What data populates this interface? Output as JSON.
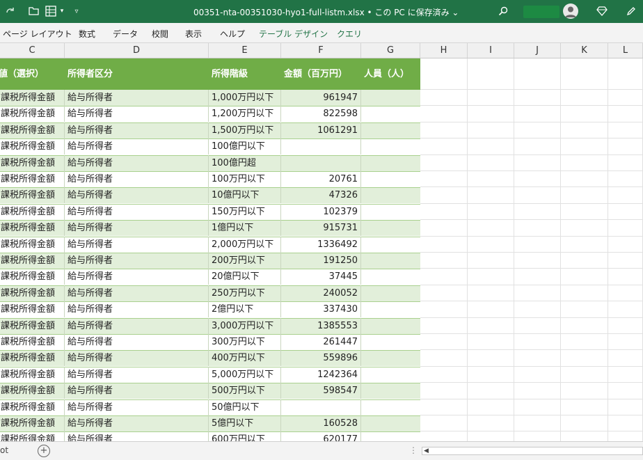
{
  "titlebar": {
    "title": "00351-nta-00351030-hyo1-full-listm.xlsx • この PC に保存済み ⌄",
    "icons": [
      "redo-icon",
      "open-folder-icon",
      "form-icon",
      "customize-qat-icon",
      "search-icon",
      "account-avatar-icon",
      "premium-diamond-icon",
      "pen-icon"
    ]
  },
  "ribbon": {
    "tabs": [
      "ページ レイアウト",
      "数式",
      "データ",
      "校閲",
      "表示",
      "ヘルプ",
      "テーブル デザイン",
      "クエリ"
    ]
  },
  "columns": [
    "C",
    "D",
    "E",
    "F",
    "G",
    "H",
    "I",
    "J",
    "K",
    "L"
  ],
  "table": {
    "headers": [
      "値（選択）",
      "所得者区分",
      "所得階級",
      "金額（百万円）",
      "人員（人）"
    ],
    "rows": [
      {
        "c": "課税所得金額",
        "d": "給与所得者",
        "e": "1,000万円以下",
        "f": "961947",
        "g": ""
      },
      {
        "c": "課税所得金額",
        "d": "給与所得者",
        "e": "1,200万円以下",
        "f": "822598",
        "g": ""
      },
      {
        "c": "課税所得金額",
        "d": "給与所得者",
        "e": "1,500万円以下",
        "f": "1061291",
        "g": ""
      },
      {
        "c": "課税所得金額",
        "d": "給与所得者",
        "e": "100億円以下",
        "f": "",
        "g": ""
      },
      {
        "c": "課税所得金額",
        "d": "給与所得者",
        "e": "100億円超",
        "f": "",
        "g": ""
      },
      {
        "c": "課税所得金額",
        "d": "給与所得者",
        "e": "100万円以下",
        "f": "20761",
        "g": ""
      },
      {
        "c": "課税所得金額",
        "d": "給与所得者",
        "e": "10億円以下",
        "f": "47326",
        "g": ""
      },
      {
        "c": "課税所得金額",
        "d": "給与所得者",
        "e": "150万円以下",
        "f": "102379",
        "g": ""
      },
      {
        "c": "課税所得金額",
        "d": "給与所得者",
        "e": "1億円以下",
        "f": "915731",
        "g": ""
      },
      {
        "c": "課税所得金額",
        "d": "給与所得者",
        "e": "2,000万円以下",
        "f": "1336492",
        "g": ""
      },
      {
        "c": "課税所得金額",
        "d": "給与所得者",
        "e": "200万円以下",
        "f": "191250",
        "g": ""
      },
      {
        "c": "課税所得金額",
        "d": "給与所得者",
        "e": "20億円以下",
        "f": "37445",
        "g": ""
      },
      {
        "c": "課税所得金額",
        "d": "給与所得者",
        "e": "250万円以下",
        "f": "240052",
        "g": ""
      },
      {
        "c": "課税所得金額",
        "d": "給与所得者",
        "e": "2億円以下",
        "f": "337430",
        "g": ""
      },
      {
        "c": "課税所得金額",
        "d": "給与所得者",
        "e": "3,000万円以下",
        "f": "1385553",
        "g": ""
      },
      {
        "c": "課税所得金額",
        "d": "給与所得者",
        "e": "300万円以下",
        "f": "261447",
        "g": ""
      },
      {
        "c": "課税所得金額",
        "d": "給与所得者",
        "e": "400万円以下",
        "f": "559896",
        "g": ""
      },
      {
        "c": "課税所得金額",
        "d": "給与所得者",
        "e": "5,000万円以下",
        "f": "1242364",
        "g": ""
      },
      {
        "c": "課税所得金額",
        "d": "給与所得者",
        "e": "500万円以下",
        "f": "598547",
        "g": ""
      },
      {
        "c": "課税所得金額",
        "d": "給与所得者",
        "e": "50億円以下",
        "f": "",
        "g": ""
      },
      {
        "c": "課税所得金額",
        "d": "給与所得者",
        "e": "5億円以下",
        "f": "160528",
        "g": ""
      },
      {
        "c": "課税所得金額",
        "d": "給与所得者",
        "e": "600万円以下",
        "f": "620177",
        "g": ""
      }
    ]
  },
  "statusbar": {
    "sheet_tab": "ot",
    "add_sheet": "+",
    "dots": "⋮",
    "scroll_left": "◀"
  },
  "colors": {
    "excel_green": "#217346",
    "header_fill": "#70ad47",
    "band_fill": "#e2efda"
  }
}
